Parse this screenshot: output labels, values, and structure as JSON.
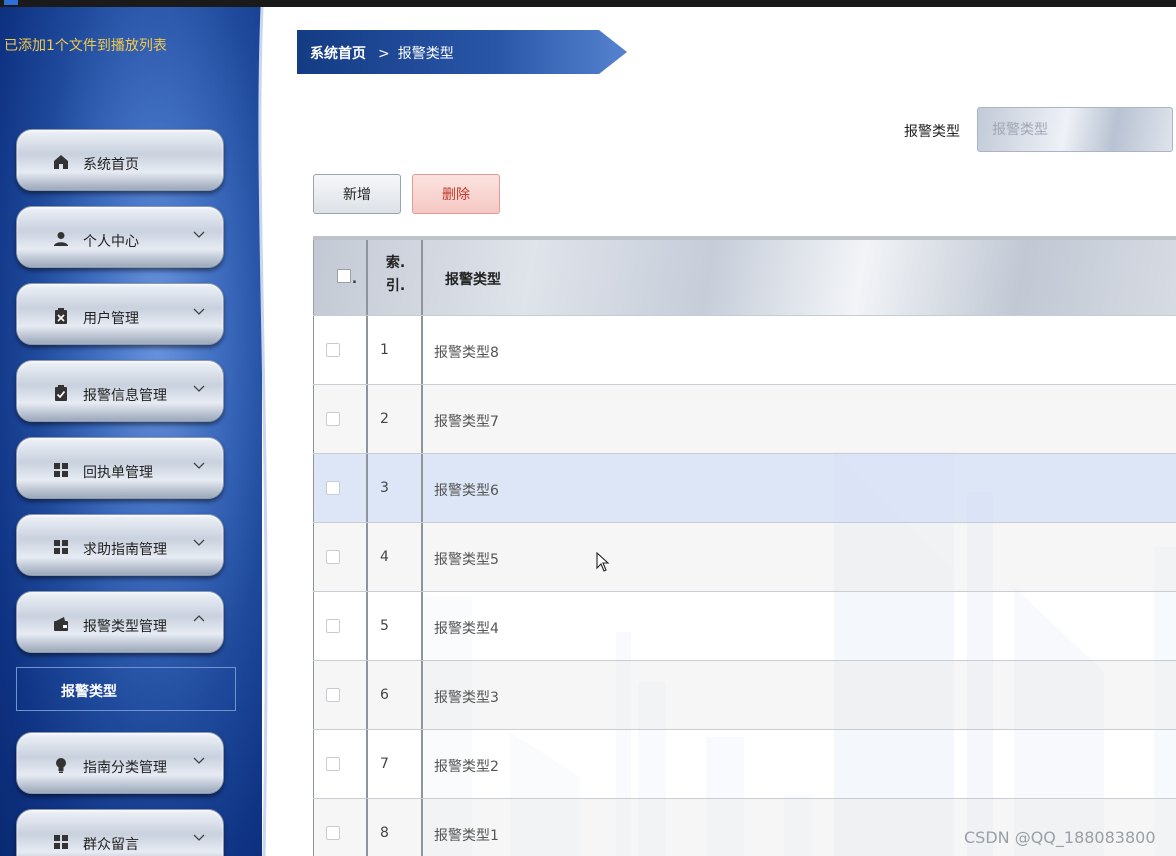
{
  "sidebar": {
    "notice": "已添加1个文件到播放列表",
    "menu": [
      {
        "label": "系统首页",
        "icon": "home-icon",
        "chevron": "none"
      },
      {
        "label": "个人中心",
        "icon": "person-icon",
        "chevron": "down"
      },
      {
        "label": "用户管理",
        "icon": "clipboard-x-icon",
        "chevron": "down"
      },
      {
        "label": "报警信息管理",
        "icon": "clipboard-check-icon",
        "chevron": "down"
      },
      {
        "label": "回执单管理",
        "icon": "grid-icon",
        "chevron": "down"
      },
      {
        "label": "求助指南管理",
        "icon": "grid-icon",
        "chevron": "down"
      },
      {
        "label": "报警类型管理",
        "icon": "wallet-icon",
        "chevron": "up"
      },
      {
        "label": "指南分类管理",
        "icon": "bulb-icon",
        "chevron": "down"
      },
      {
        "label": "群众留言",
        "icon": "grid-icon",
        "chevron": "down"
      }
    ],
    "submenu": {
      "label": "报警类型"
    }
  },
  "breadcrumb": {
    "home": "系统首页",
    "separator": ">",
    "current": "报警类型"
  },
  "search": {
    "label": "报警类型",
    "placeholder": "报警类型",
    "value": ""
  },
  "toolbar": {
    "add_label": "新增",
    "delete_label": "删除"
  },
  "table": {
    "headers": {
      "index_line1": "索.",
      "index_line2": "引.",
      "type": "报警类型",
      "check_suffix": "."
    },
    "rows": [
      {
        "index": "1",
        "type": "报警类型8",
        "highlighted": false
      },
      {
        "index": "2",
        "type": "报警类型7",
        "highlighted": false
      },
      {
        "index": "3",
        "type": "报警类型6",
        "highlighted": true
      },
      {
        "index": "4",
        "type": "报警类型5",
        "highlighted": false
      },
      {
        "index": "5",
        "type": "报警类型4",
        "highlighted": false
      },
      {
        "index": "6",
        "type": "报警类型3",
        "highlighted": false
      },
      {
        "index": "7",
        "type": "报警类型2",
        "highlighted": false
      },
      {
        "index": "8",
        "type": "报警类型1",
        "highlighted": false
      }
    ]
  },
  "watermark": "CSDN @QQ_188083800",
  "colors": {
    "notice": "#f2c94c",
    "sidebar": "#1f4a9c",
    "breadcrumb": "#2a4f9e",
    "delete": "#c0392b",
    "highlight_row": "#dae4f6"
  }
}
